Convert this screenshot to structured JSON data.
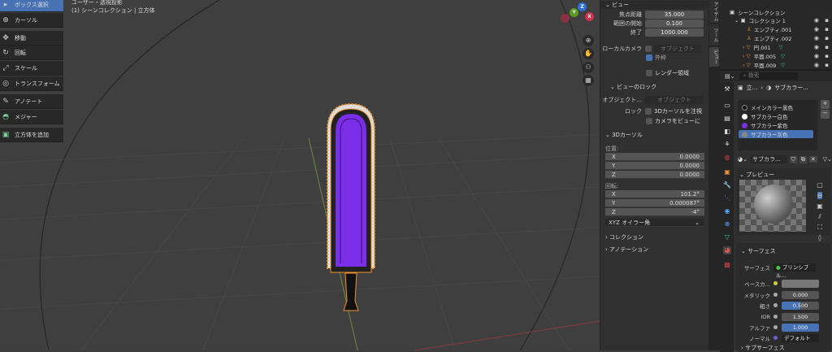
{
  "toolbar": {
    "items": [
      {
        "label": "ボックス選択",
        "icon": "select-box-icon"
      },
      {
        "label": "カーソル",
        "icon": "cursor-icon"
      },
      {
        "label": "移動",
        "icon": "move-icon"
      },
      {
        "label": "回転",
        "icon": "rotate-icon"
      },
      {
        "label": "スケール",
        "icon": "scale-icon"
      },
      {
        "label": "トランスフォーム",
        "icon": "transform-icon"
      },
      {
        "label": "アノテート",
        "icon": "annotate-icon"
      },
      {
        "label": "メジャー",
        "icon": "measure-icon"
      },
      {
        "label": "立方体を追加",
        "icon": "add-cube-icon"
      }
    ]
  },
  "viewport": {
    "view_mode": "ユーザー・透視投影",
    "context": "(1) シーンコレクション | 立方体",
    "gizmo": {
      "x": "X",
      "y": "Y",
      "z": "Z"
    },
    "colors": {
      "blade": "#7a2ee8",
      "outline": "#f0922b"
    }
  },
  "npanel": {
    "view_header": "ビュー",
    "focal_label": "焦点距離",
    "focal": "35.000",
    "clip_start_label": "範囲の開始",
    "clip_start": "0.100",
    "clip_end_label": "終了",
    "clip_end": "1000.000",
    "local_camera_label": "ローカルカメラ",
    "object_placeholder": "オブジェクト",
    "frame_label": "外枠",
    "render_region_label": "レンダー領域",
    "view_lock_header": "ビューのロック",
    "lock_object_label": "オブジェクト...",
    "lock_label": "ロック",
    "lock_cursor_label": "3Dカーソルを注視",
    "camera_to_view_label": "カメラをビューに",
    "cursor_header": "3Dカーソル",
    "location_label": "位置:",
    "loc": {
      "x": "0.0000",
      "y": "0.0000",
      "z": "0.0000"
    },
    "rotation_label": "回転:",
    "rot": {
      "x": "101.2°",
      "y": "0.000087°",
      "z": "-4°"
    },
    "axis_labels": {
      "x": "X",
      "y": "Y",
      "z": "Z"
    },
    "rot_mode": "XYZ オイラー角",
    "collection_header": "コレクション",
    "annotation_header": "アノテーション",
    "tabs": [
      "アイテム",
      "ツール",
      "ビュー"
    ]
  },
  "outliner": {
    "search_placeholder": "検索",
    "items": [
      {
        "label": "シーンコレクション"
      },
      {
        "label": "コレクション 1"
      },
      {
        "label": "エンプティ.001"
      },
      {
        "label": "エンプティ.002"
      },
      {
        "label": "円.001"
      },
      {
        "label": "平面.005"
      },
      {
        "label": "平面.009"
      }
    ]
  },
  "properties": {
    "search_placeholder": "検索",
    "breadcrumb_object": "立...",
    "breadcrumb_material": "サブカラー...",
    "materials": [
      {
        "label": "メインカラー黒色",
        "color": "#111111"
      },
      {
        "label": "サブカラー白色",
        "color": "#ffffff"
      },
      {
        "label": "サブカラー紫色",
        "color": "#7a2ee8"
      },
      {
        "label": "サブカラー灰色",
        "color": "#888888"
      }
    ],
    "material_name": "サブカラ...",
    "preview_header": "プレビュー",
    "surface_header": "サーフェス",
    "surface_label": "サーフェス",
    "surface_value": "プリンシプル...",
    "base_color_label": "ベースカ...",
    "metallic_label": "メタリック",
    "metallic": "0.000",
    "roughness_label": "粗さ",
    "roughness": "0.500",
    "ior_label": "IOR",
    "ior": "1.500",
    "alpha_label": "アルファ",
    "alpha": "1.000",
    "normal_label": "ノーマル",
    "normal_value": "デフォルト",
    "subsurface_header": "サブサーフェス"
  }
}
